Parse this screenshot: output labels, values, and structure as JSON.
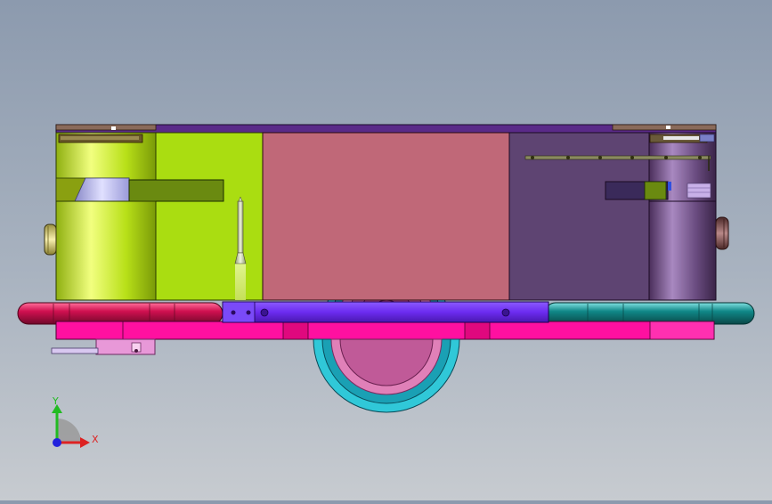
{
  "viewport": {
    "background_top": "#8c9aae",
    "background_bottom": "#c7cbd0"
  },
  "triad": {
    "y_label": "Y",
    "x_label": "X",
    "y_color": "#22bb22",
    "x_color": "#dd2222",
    "z_color": "#2222dd"
  },
  "colors": {
    "lime": "#aadd11",
    "rose": "#c06878",
    "purple": "#5e4472",
    "blue_bar": "#6c2cf0",
    "magenta": "#ff10a0",
    "red_bumper": "#d01050",
    "teal_bumper": "#108888",
    "wheel_cyan": "#30c8d8",
    "olive": "#6a8a10",
    "brown_knob": "#7a4848",
    "pink_pedal": "#e898d8"
  }
}
